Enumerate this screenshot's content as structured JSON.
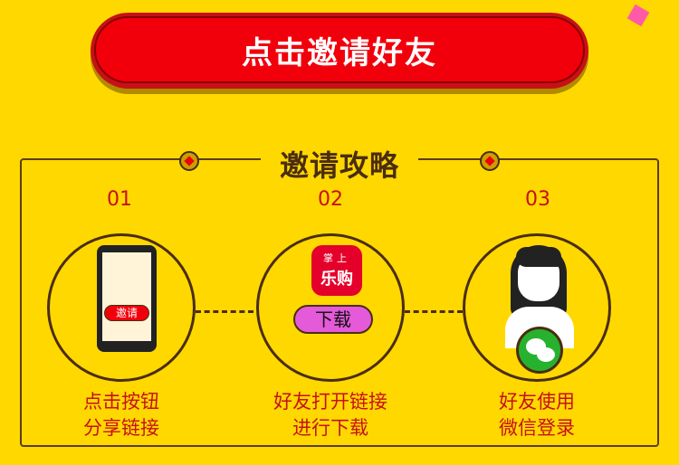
{
  "header": {
    "invite_button": "点击邀请好友"
  },
  "guide": {
    "title": "邀请攻略",
    "steps": [
      {
        "number": "01",
        "line1": "点击按钮",
        "line2": "分享链接",
        "button_label": "邀请"
      },
      {
        "number": "02",
        "line1": "好友打开链接",
        "line2": "进行下载",
        "app_name_line1": "掌上",
        "app_name_line2": "乐购",
        "button_label": "下载"
      },
      {
        "number": "03",
        "line1": "好友使用",
        "line2": "微信登录"
      }
    ]
  },
  "colors": {
    "background": "#ffd800",
    "accent_red": "#f1000c",
    "text_brown": "#4a2d10",
    "download_pink": "#e45ad8",
    "wechat_green": "#26b22e"
  }
}
